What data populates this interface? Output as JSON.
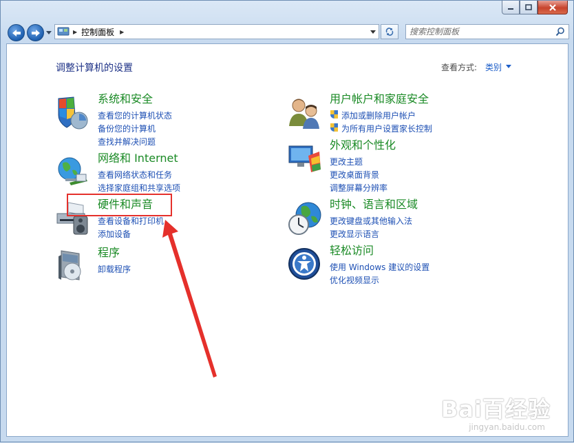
{
  "window": {
    "controls": {
      "minimize_icon": "minimize-icon",
      "maximize_icon": "maximize-icon",
      "close_icon": "close-icon"
    }
  },
  "toolbar": {
    "address_crumb": "控制面板",
    "search_placeholder": "搜索控制面板"
  },
  "header": {
    "title": "调整计算机的设置",
    "view_label": "查看方式:",
    "view_value": "类别"
  },
  "categories": [
    {
      "title": "系统和安全",
      "icon": "system-security-icon",
      "links": [
        "查看您的计算机状态",
        "备份您的计算机",
        "查找并解决问题"
      ]
    },
    {
      "title": "网络和 Internet",
      "icon": "network-internet-icon",
      "links": [
        "查看网络状态和任务",
        "选择家庭组和共享选项"
      ]
    },
    {
      "title": "硬件和声音",
      "icon": "hardware-sound-icon",
      "links": [
        "查看设备和打印机",
        "添加设备"
      ]
    },
    {
      "title": "程序",
      "icon": "programs-icon",
      "links": [
        "卸载程序"
      ]
    },
    {
      "title": "用户帐户和家庭安全",
      "icon": "user-accounts-icon",
      "links": [
        "添加或删除用户帐户",
        "为所有用户设置家长控制"
      ]
    },
    {
      "title": "外观和个性化",
      "icon": "appearance-icon",
      "links": [
        "更改主题",
        "更改桌面背景",
        "调整屏幕分辨率"
      ]
    },
    {
      "title": "时钟、语言和区域",
      "icon": "clock-language-icon",
      "links": [
        "更改键盘或其他输入法",
        "更改显示语言"
      ]
    },
    {
      "title": "轻松访问",
      "icon": "ease-of-access-icon",
      "links": [
        "使用 Windows 建议的设置",
        "优化视频显示"
      ]
    }
  ],
  "annotation": {
    "highlight_color": "#e5302b"
  },
  "watermark": {
    "brand": "Bai百经验",
    "url": "jingyan.baidu.com"
  }
}
